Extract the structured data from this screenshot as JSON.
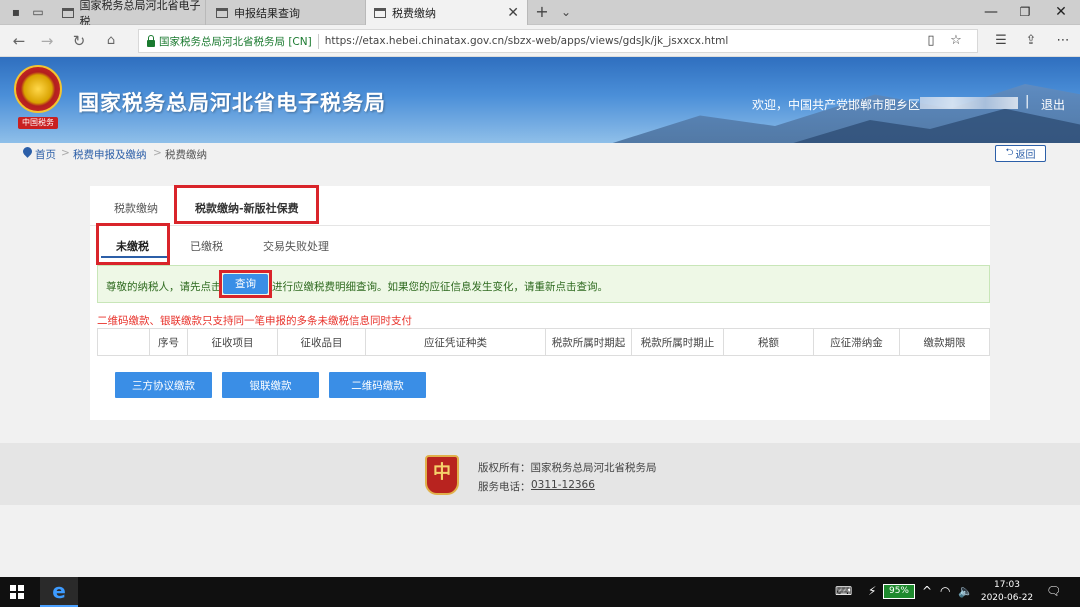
{
  "browser": {
    "tabs": [
      {
        "label": "国家税务总局河北省电子税"
      },
      {
        "label": "申报结果查询"
      },
      {
        "label": "税费缴纳"
      }
    ],
    "site_identity": "国家税务总局河北省税务局 [CN]",
    "url": "https://etax.hebei.chinatax.gov.cn/sbzx-web/apps/views/gdsJk/jk_jsxxcx.html"
  },
  "header": {
    "site_title": "国家税务总局河北省电子税务局",
    "emblem_text": "中国税务",
    "welcome": "欢迎，中国共产党邯郸市肥乡区",
    "separator": "|",
    "logout": "退出"
  },
  "breadcrumb": {
    "home": "首页",
    "level1": "税费申报及缴纳",
    "level2": "税费缴纳",
    "sep": ">",
    "back": "返回"
  },
  "tabs_main": [
    "税款缴纳",
    "税款缴纳-新版社保费"
  ],
  "tabs_sub": [
    "未缴税",
    "已缴税",
    "交易失败处理"
  ],
  "notice": {
    "before": "尊敬的纳税人，请先点击",
    "button": "查询",
    "after": "进行应缴税费明细查询。如果您的应征信息发生变化，请重新点击查询。"
  },
  "warning": "二维码缴款、银联缴款只支持同一笔申报的多条未缴税信息同时支付",
  "table": {
    "columns": [
      "序号",
      "征收项目",
      "征收品目",
      "应征凭证种类",
      "税款所属时期起",
      "税款所属时期止",
      "税额",
      "应征滞纳金",
      "缴款期限"
    ]
  },
  "actions": [
    "三方协议缴款",
    "银联缴款",
    "二维码缴款"
  ],
  "footer": {
    "logo_text": "中",
    "copyright": "版权所有：国家税务总局河北省税务局",
    "phone_label": "服务电话：",
    "phone": "0311-12366"
  },
  "taskbar": {
    "battery": "95%",
    "time": "17:03",
    "date": "2020-06-22"
  },
  "colors": {
    "accent": "#3a8ee6",
    "highlight": "#d9242a",
    "warning": "#e8322b"
  }
}
